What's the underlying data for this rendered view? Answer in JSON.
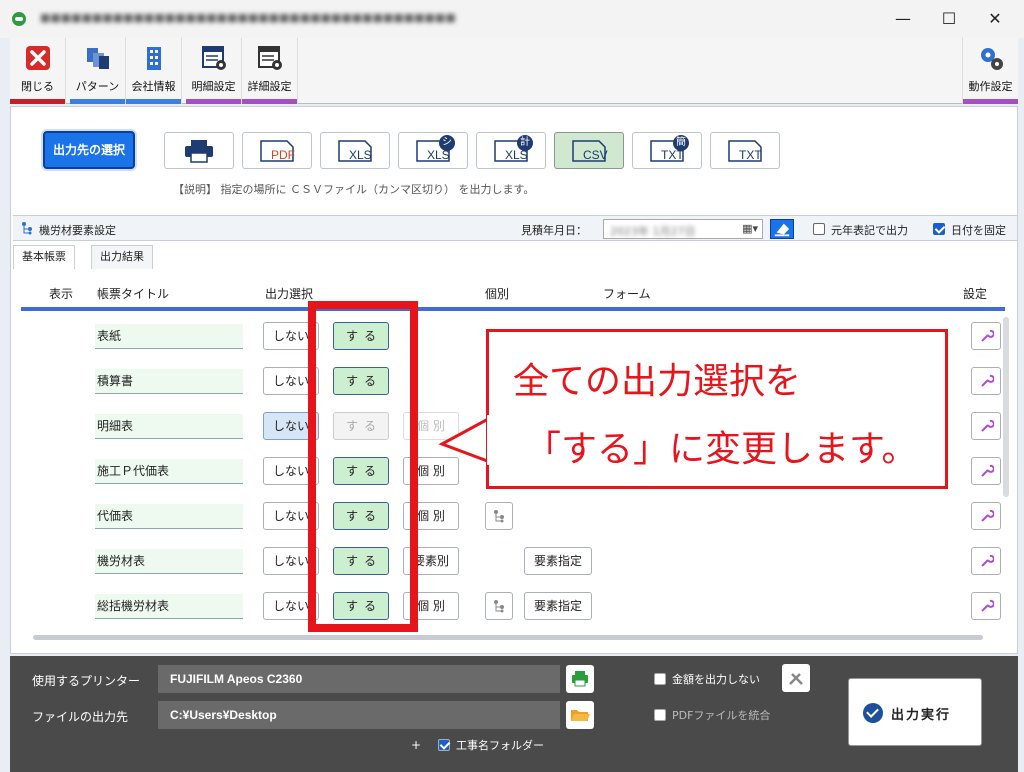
{
  "window": {
    "title": "",
    "minimize": "—",
    "maximize": "☐",
    "close": "✕"
  },
  "ribbon": {
    "items": [
      {
        "label": "閉じる",
        "icon": "close-icon"
      },
      {
        "label": "パターン",
        "icon": "pattern-icon"
      },
      {
        "label": "会社情報",
        "icon": "building-icon"
      },
      {
        "label": "明細設定",
        "icon": "detail-settings-icon"
      },
      {
        "label": "詳細設定",
        "icon": "advanced-settings-icon"
      },
      {
        "label": "動作設定",
        "icon": "gears-icon"
      }
    ]
  },
  "output": {
    "select_label": "出力先の選択",
    "formats": [
      {
        "type": "printer",
        "label": ""
      },
      {
        "type": "PDF",
        "label": "PDF"
      },
      {
        "type": "XLS",
        "label": "XLS"
      },
      {
        "type": "XLS-shi",
        "label": "XLS",
        "badge": "シ"
      },
      {
        "type": "XLS-kei",
        "label": "XLS",
        "badge": "計"
      },
      {
        "type": "CSV",
        "label": "CSV",
        "active": true
      },
      {
        "type": "TXT-kan",
        "label": "TXT",
        "badge": "簡"
      },
      {
        "type": "TXT",
        "label": "TXT"
      }
    ],
    "description": "【説明】 指定の場所に ＣＳＶファイル（カンマ区切り） を出力します。"
  },
  "subbar": {
    "caption": "機労材要素設定",
    "date_label": "見積年月日：",
    "date_value": "2023年 1月27日",
    "era_label": "元年表記で出力",
    "fix_date_label": "日付を固定"
  },
  "tabs": [
    "基本帳票",
    "出力結果"
  ],
  "columns": {
    "show": "表示",
    "title": "帳票タイトル",
    "output": "出力選択",
    "individual": "個別",
    "form": "フォーム",
    "settings": "設定"
  },
  "rows": [
    {
      "title": "表紙",
      "no": "しない",
      "yes": "する",
      "individual": "",
      "tree": false,
      "form": ""
    },
    {
      "title": "積算書",
      "no": "しない",
      "yes": "する",
      "individual": "",
      "tree": false,
      "form": ""
    },
    {
      "title": "明細表",
      "no": "しない",
      "yes": "する",
      "individual": "個 別",
      "tree": false,
      "form": "",
      "no_selected": true,
      "yes_disabled": true
    },
    {
      "title": "施工Ｐ代価表",
      "no": "しない",
      "yes": "する",
      "individual": "個 別",
      "tree": false,
      "form": ""
    },
    {
      "title": "代価表",
      "no": "しない",
      "yes": "する",
      "individual": "個 別",
      "tree": true,
      "form": ""
    },
    {
      "title": "機労材表",
      "no": "しない",
      "yes": "する",
      "individual": "要素別",
      "tree": false,
      "form": "要素指定"
    },
    {
      "title": "総括機労材表",
      "no": "しない",
      "yes": "する",
      "individual": "個 別",
      "tree": true,
      "form": "要素指定"
    }
  ],
  "callout": {
    "line1": "全ての出力選択を",
    "line2": "「する」に変更します。"
  },
  "bottom": {
    "printer_label": "使用するプリンター",
    "printer_value": "FUJIFILM Apeos C2360",
    "dest_label": "ファイルの出力先",
    "dest_value": "C:¥Users¥Desktop",
    "no_amount_label": "金額を出力しない",
    "merge_pdf_label": "PDFファイルを統合",
    "plus": "+",
    "folder_label": "工事名フォルダー",
    "exec_label": "出力実行"
  },
  "colors": {
    "accent": "#1a73e8",
    "callout": "#e8141c",
    "yes_bg": "#ccefd0"
  }
}
